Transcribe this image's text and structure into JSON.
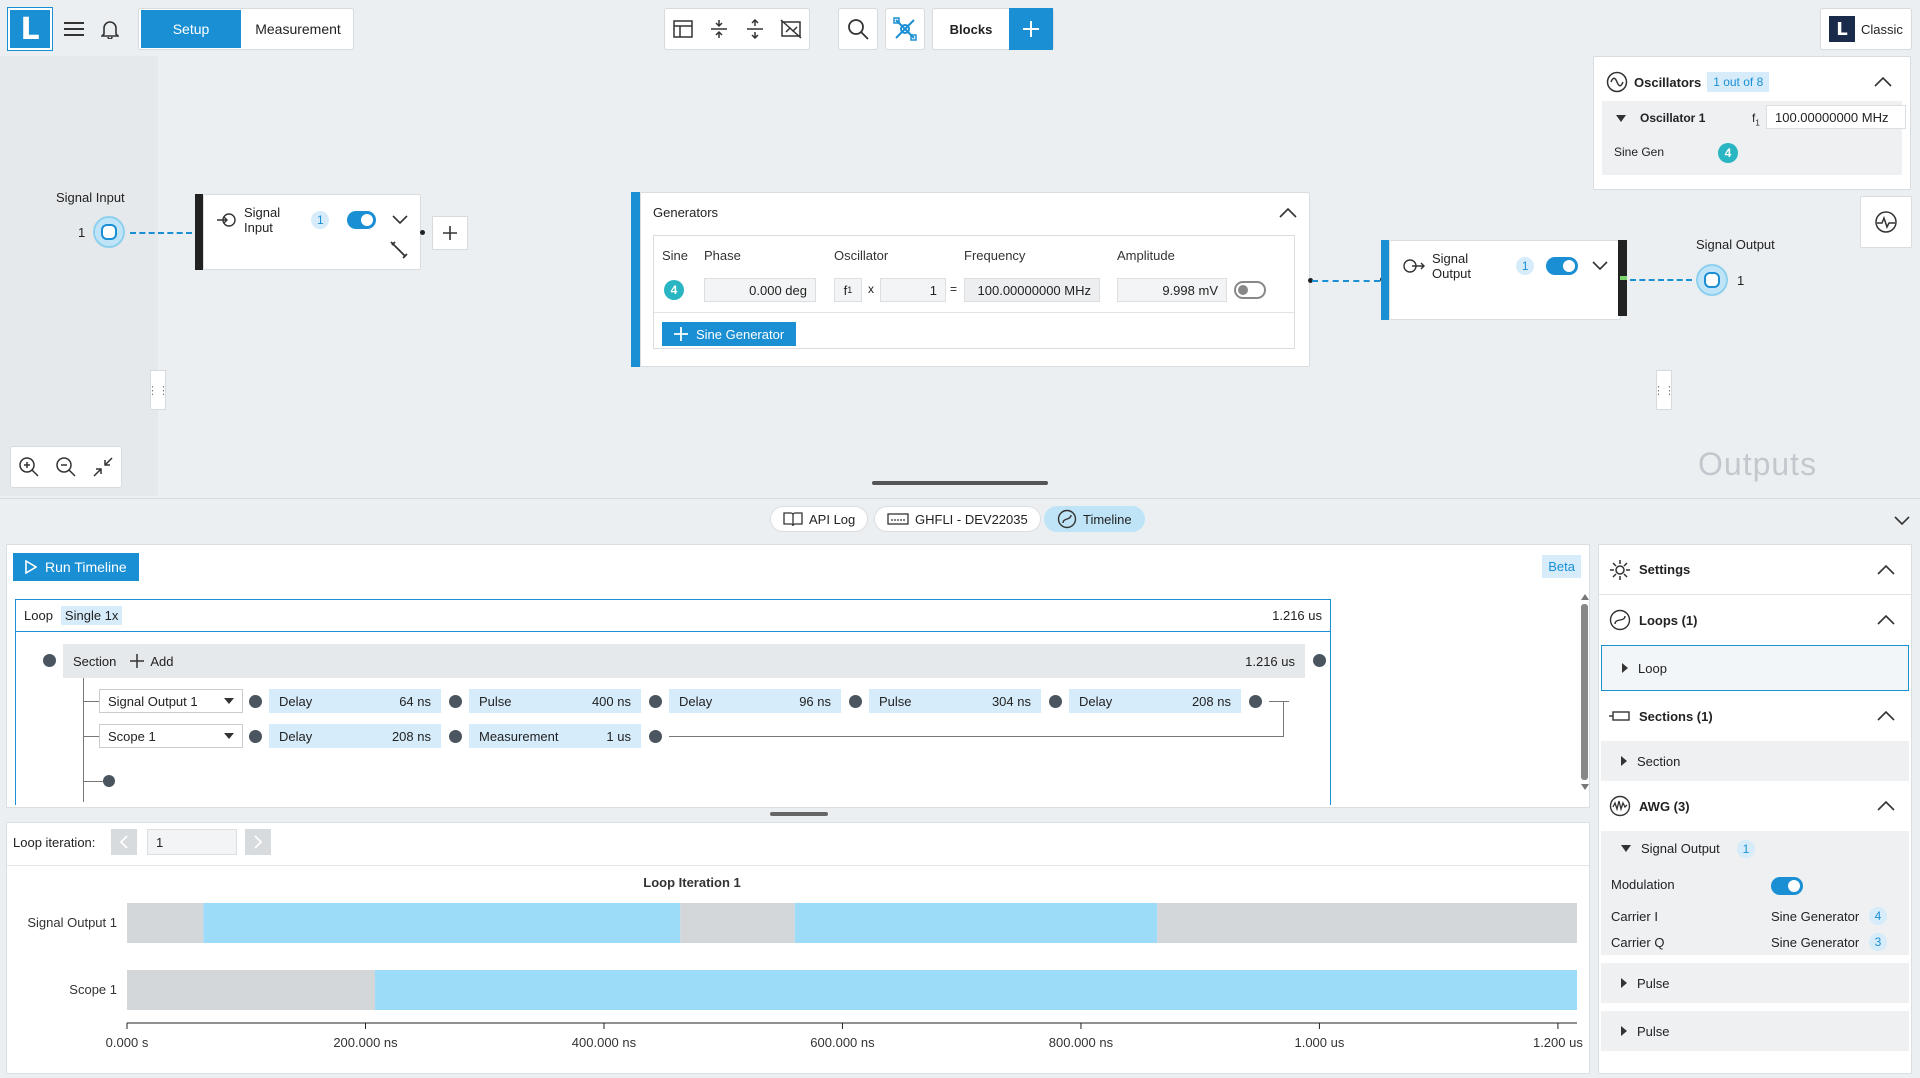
{
  "header": {
    "logo_text": "L",
    "tabs": [
      "Setup",
      "Measurement"
    ],
    "blocks_label": "Blocks",
    "classic_label": "Classic",
    "toolbar_icons": [
      "layout-icon",
      "collapse-vertical-icon",
      "expand-vertical-icon",
      "hide-connections-icon",
      "search-icon",
      "network-icon"
    ]
  },
  "oscillators": {
    "title": "Oscillators",
    "count_badge": "1 out of 8",
    "oscillator_name": "Oscillator 1",
    "freq_symbol": "f",
    "freq_sub": "1",
    "freq_value": "100.00000000 MHz",
    "sine_gen_label": "Sine Gen",
    "sine_gen_badge": "4"
  },
  "signal_input": {
    "port_label": "Signal Input",
    "port_number": "1",
    "block_label": "Signal Input",
    "block_badge": "1"
  },
  "generators": {
    "title": "Generators",
    "col_sine": "Sine",
    "col_phase": "Phase",
    "col_oscillator": "Oscillator",
    "col_frequency": "Frequency",
    "col_amplitude": "Amplitude",
    "sine_badge": "4",
    "phase": "0.000 deg",
    "osc_symbol": "f",
    "osc_sub": "1",
    "times": "x",
    "multiplier": "1",
    "equals": "=",
    "frequency": "100.00000000 MHz",
    "amplitude": "9.998 mV",
    "add_button": "Sine Generator"
  },
  "signal_output": {
    "block_label": "Signal Output",
    "block_badge": "1",
    "port_label": "Signal Output",
    "port_number": "1"
  },
  "canvas": {
    "outputs_watermark": "Outputs"
  },
  "bottom_tabs": [
    "API Log",
    "GHFLI - DEV22035",
    "Timeline"
  ],
  "timeline": {
    "run_label": "Run Timeline",
    "beta_label": "Beta",
    "loop_label": "Loop",
    "loop_mode": "Single 1x",
    "loop_duration": "1.216 us",
    "section_label": "Section",
    "add_label": "Add",
    "section_duration": "1.216 us",
    "rows": [
      {
        "channel": "Signal Output 1",
        "blocks": [
          {
            "name": "Delay",
            "dur": "64 ns"
          },
          {
            "name": "Pulse",
            "dur": "400 ns"
          },
          {
            "name": "Delay",
            "dur": "96 ns"
          },
          {
            "name": "Pulse",
            "dur": "304 ns"
          },
          {
            "name": "Delay",
            "dur": "208 ns"
          }
        ]
      },
      {
        "channel": "Scope 1",
        "blocks": [
          {
            "name": "Delay",
            "dur": "208 ns"
          },
          {
            "name": "Measurement",
            "dur": "1 us"
          }
        ]
      }
    ],
    "loop_iteration_label": "Loop iteration:",
    "loop_iteration_value": "1"
  },
  "chart_data": {
    "type": "timeline",
    "title": "Loop Iteration 1",
    "x_unit": "ns",
    "xlim": [
      0,
      1216
    ],
    "ticks": [
      "0.000 s",
      "200.000 ns",
      "400.000 ns",
      "600.000 ns",
      "800.000 ns",
      "1.000 us",
      "1.200 us"
    ],
    "tick_values": [
      0,
      200,
      400,
      600,
      800,
      1000,
      1200
    ],
    "series": [
      {
        "name": "Signal Output 1",
        "segments": [
          {
            "kind": "delay",
            "start": 0,
            "end": 64
          },
          {
            "kind": "pulse",
            "start": 64,
            "end": 464
          },
          {
            "kind": "delay",
            "start": 464,
            "end": 560
          },
          {
            "kind": "pulse",
            "start": 560,
            "end": 864
          },
          {
            "kind": "delay",
            "start": 864,
            "end": 1216
          }
        ]
      },
      {
        "name": "Scope 1",
        "segments": [
          {
            "kind": "delay",
            "start": 0,
            "end": 208
          },
          {
            "kind": "pulse",
            "start": 208,
            "end": 1216
          }
        ]
      }
    ],
    "colors": {
      "delay": "#d4d7da",
      "pulse": "#9ddcf9"
    }
  },
  "settings": {
    "title": "Settings",
    "loops_title": "Loops (1)",
    "loop_item": "Loop",
    "sections_title": "Sections (1)",
    "section_item": "Section",
    "awg_title": "AWG (3)",
    "awg_output": "Signal Output",
    "awg_output_badge": "1",
    "modulation_label": "Modulation",
    "carrier_i_label": "Carrier I",
    "carrier_i_value": "Sine Generator",
    "carrier_i_badge": "4",
    "carrier_q_label": "Carrier Q",
    "carrier_q_value": "Sine Generator",
    "carrier_q_badge": "3",
    "pulse_item": "Pulse",
    "pulse_item2": "Pulse"
  },
  "colors": {
    "accent": "#1a8fd4",
    "pulse": "#9ddcf9",
    "delay": "#d4d7da"
  }
}
